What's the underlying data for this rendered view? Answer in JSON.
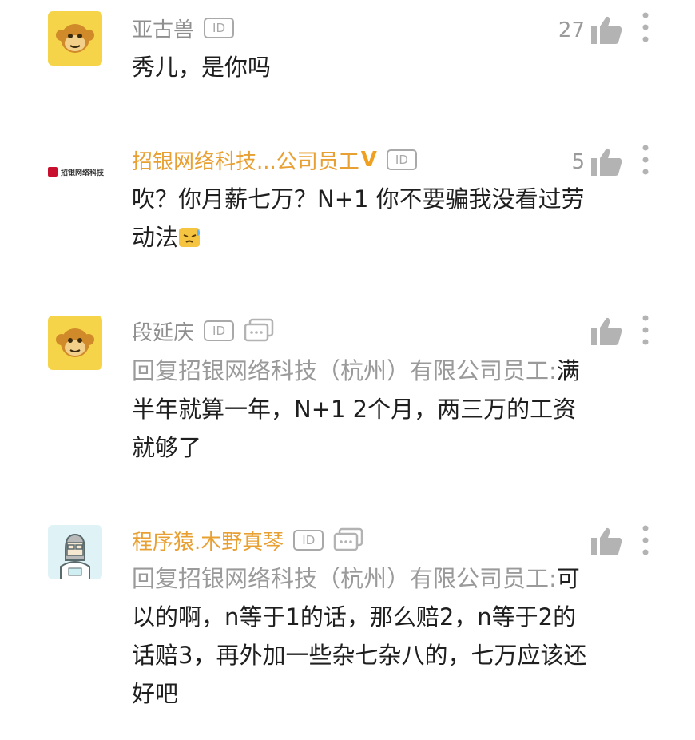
{
  "comments": [
    {
      "username": "亚古兽",
      "id_badge": "ID",
      "likes": "27",
      "avatar": "monkey-avatar",
      "text": "秀儿，是你吗"
    },
    {
      "username": "招银网络科技...公司员工",
      "verified_badge": "V",
      "id_badge": "ID",
      "likes": "5",
      "avatar_logo_text": "招银网络科技",
      "text": "吹？你月薪七万？N+1 你不要骗我没看过劳动法"
    },
    {
      "username": "段延庆",
      "id_badge": "ID",
      "likes": "",
      "avatar": "monkey-avatar",
      "reply_prefix": "回复招银网络科技（杭州）有限公司员工:",
      "text": "满半年就算一年，N+1 2个月，两三万的工资就够了"
    },
    {
      "username": "程序猿.木野真琴",
      "id_badge": "ID",
      "likes": "",
      "avatar": "programmer-avatar",
      "reply_prefix": "回复招银网络科技（杭州）有限公司员工:",
      "text": "可以的啊，n等于1的话，那么赔2，n等于2的话赔3，再外加一些杂七杂八的，七万应该还好吧"
    }
  ],
  "colors": {
    "username": "#8f8f8f",
    "vip_username": "#e8a033",
    "reply_prefix": "#9a9a9a",
    "icon_gray": "#a9a9a9"
  },
  "icons": [
    "thumbs-up-icon",
    "more-vertical-icon",
    "id-badge-icon",
    "chat-bubble-icon",
    "sweat-emoji-icon"
  ]
}
